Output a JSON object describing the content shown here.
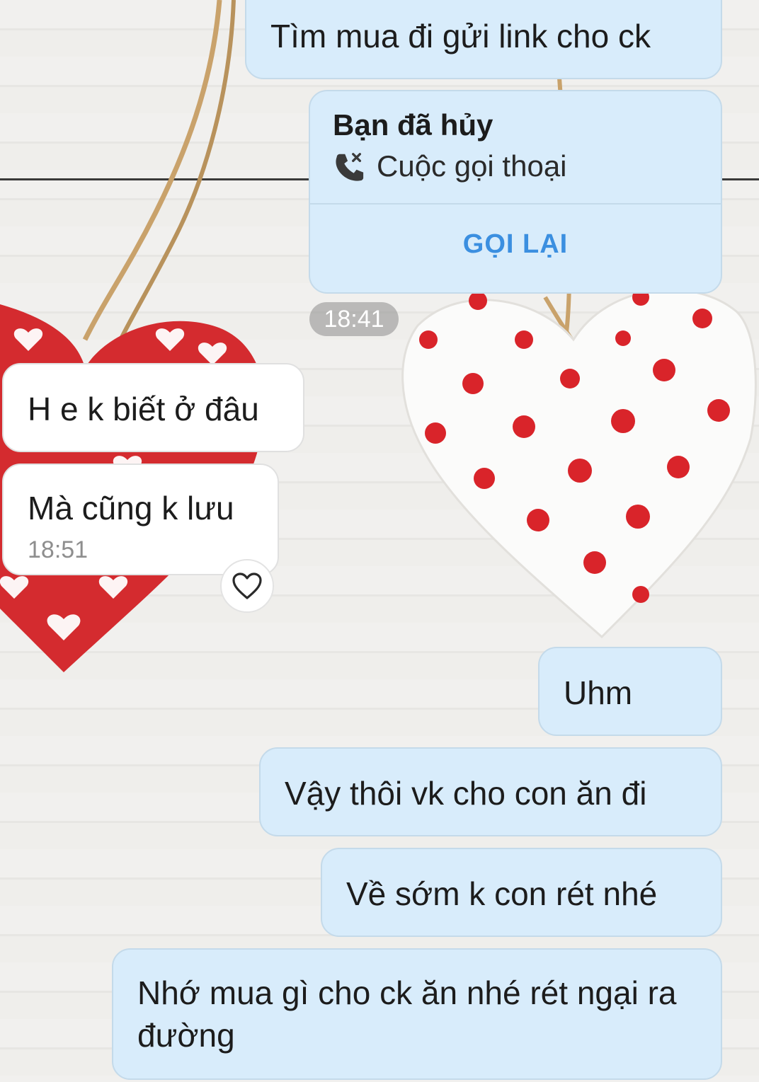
{
  "messages": [
    {
      "text": "Tìm mua đi gửi link cho ck"
    },
    {
      "text": "H e k biết ở đâu"
    },
    {
      "text": "Mà cũng k lưu",
      "time": "18:51"
    },
    {
      "text": "Uhm"
    },
    {
      "text": "Vậy thôi vk cho con ăn đi"
    },
    {
      "text": "Về sớm k con rét nhé"
    },
    {
      "text": "Nhớ mua gì cho ck ăn nhé rét ngại ra đường"
    }
  ],
  "call": {
    "status": "Bạn đã hủy",
    "type": "Cuộc gọi thoại",
    "action": "GỌI LẠI",
    "icon": "missed-call-icon"
  },
  "time_separator": "18:41",
  "reaction": {
    "icon": "heart-outline-icon"
  },
  "colors": {
    "outgoing_bubble": "#d8ecfb",
    "incoming_bubble": "#ffffff",
    "call_action": "#3b8fe0"
  }
}
